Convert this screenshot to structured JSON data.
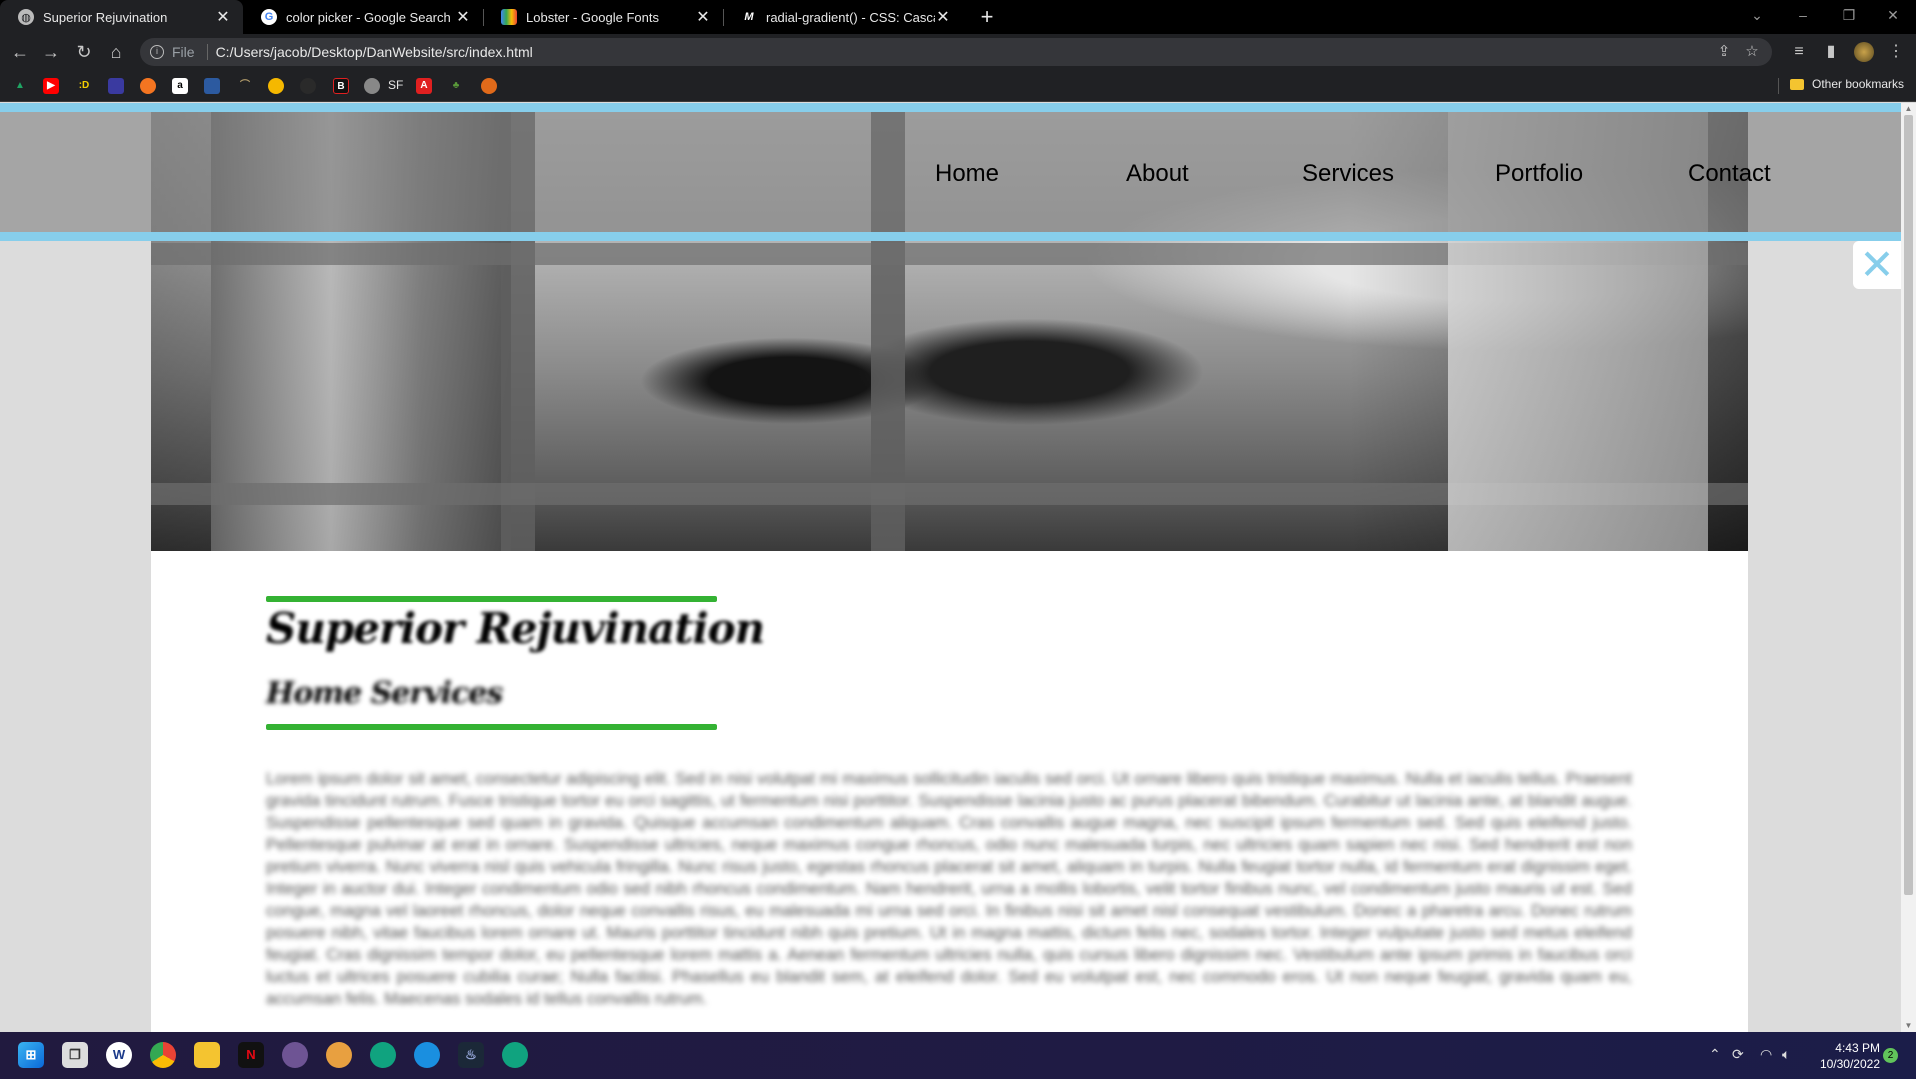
{
  "tabs": [
    {
      "title": "Superior Rejuvination",
      "icon": "globe-icon",
      "active": true
    },
    {
      "title": "color picker - Google Search",
      "icon": "google-icon",
      "active": false
    },
    {
      "title": "Lobster - Google Fonts",
      "icon": "google-fonts-icon",
      "active": false
    },
    {
      "title": "radial-gradient() - CSS: Cascading",
      "icon": "mdn-icon",
      "active": false
    }
  ],
  "tab_close_glyph": "✕",
  "omnibox": {
    "scheme_label": "File",
    "url": "C:/Users/jacob/Desktop/DanWebsite/src/index.html"
  },
  "bookmarks": {
    "items": [
      {
        "icon": "google-drive-icon",
        "color": "#1fa463"
      },
      {
        "icon": "youtube-icon",
        "color": "#ff0000"
      },
      {
        "icon": "d-icon",
        "color": "#f5d000",
        "glyph": ":D"
      },
      {
        "icon": "bookmark-icon",
        "color": "#3a3aa0"
      },
      {
        "icon": "crunchyroll-icon",
        "color": "#f47521"
      },
      {
        "icon": "amazon-icon",
        "color": "#ffffff",
        "glyph": "a"
      },
      {
        "icon": "rally-data-icon",
        "color": "#2c5aa0"
      },
      {
        "icon": "bookmark-icon",
        "color": "#6b5a3a"
      },
      {
        "icon": "coin-icon",
        "color": "#f5b800"
      },
      {
        "icon": "bookmark-icon",
        "color": "#333333"
      },
      {
        "icon": "b-icon",
        "color": "#111111",
        "glyph": "B"
      },
      {
        "icon": "globe-icon",
        "color": "#888888"
      },
      {
        "icon": "a-icon",
        "color": "#e02020",
        "glyph": "A"
      },
      {
        "icon": "tree-icon",
        "color": "#5a9a3a"
      },
      {
        "icon": "basketball-icon",
        "color": "#e06a1a"
      }
    ],
    "sf_label": "SF",
    "other_label": "Other bookmarks"
  },
  "site": {
    "nav": [
      "Home",
      "About",
      "Services",
      "Portfolio",
      "Contact"
    ],
    "close_glyph": "✕",
    "brand": "Superior Rejuvination",
    "subtitle": "Home Services",
    "body": "Lorem ipsum dolor sit amet, consectetur adipiscing elit. Sed in nisi volutpat mi maximus sollicitudin iaculis sed orci. Ut ornare libero quis tristique maximus. Nulla et iaculis tellus. Praesent gravida tincidunt rutrum. Fusce tristique tortor eu orci sagittis, ut fermentum nisi porttitor. Suspendisse lacinia justo ac purus placerat bibendum. Curabitur ut lacinia ante, at blandit augue. Suspendisse pellentesque sed quam in gravida. Quisque accumsan condimentum aliquam. Cras convallis augue magna, nec suscipit ipsum fermentum sed. Sed quis eleifend justo. Pellentesque pulvinar at erat in ornare. Suspendisse ultricies, neque maximus congue rhoncus, odio nunc malesuada turpis, nec ultricies quam sapien nec nisi. Sed hendrerit est non pretium viverra. Nunc viverra nisl quis vehicula fringilla. Nunc risus justo, egestas rhoncus placerat sit amet, aliquam in turpis. Nulla feugiat tortor nulla, id fermentum erat dignissim eget. Integer in auctor dui. Integer condimentum odio sed nibh rhoncus condimentum. Nam hendrerit, urna a mollis lobortis, velit tortor finibus nunc, vel condimentum justo mauris ut est. Sed congue, magna vel laoreet rhoncus, dolor neque convallis risus, eu malesuada mi urna sed orci. In finibus nisi sit amet nisl consequat vestibulum. Donec a pharetra arcu. Donec rutrum posuere nibh, vitae faucibus lorem ornare ut. Mauris porttitor tincidunt nibh quis pretium. Ut in magna mattis, dictum felis nec, sodales tortor. Integer vulputate justo sed metus eleifend feugiat. Cras dignissim tempor dolor, eu pellentesque lorem mattis a. Aenean fermentum ultricies nulla, quis cursus libero dignissim nec. Vestibulum ante ipsum primis in faucibus orci luctus et ultrices posuere cubilia curae; Nulla facilisi. Phasellus eu blandit sem, at eleifend dolor. Sed eu volutpat est, nec commodo eros. Ut non neque feugiat, gravida quam eu, accumsan felis. Maecenas sodales id tellus convallis rutrum.",
    "accent_color": "#87ceeb",
    "rule_color": "#34b233"
  },
  "taskbar": {
    "time": "4:43 PM",
    "date": "10/30/2022",
    "notification_count": "2"
  }
}
